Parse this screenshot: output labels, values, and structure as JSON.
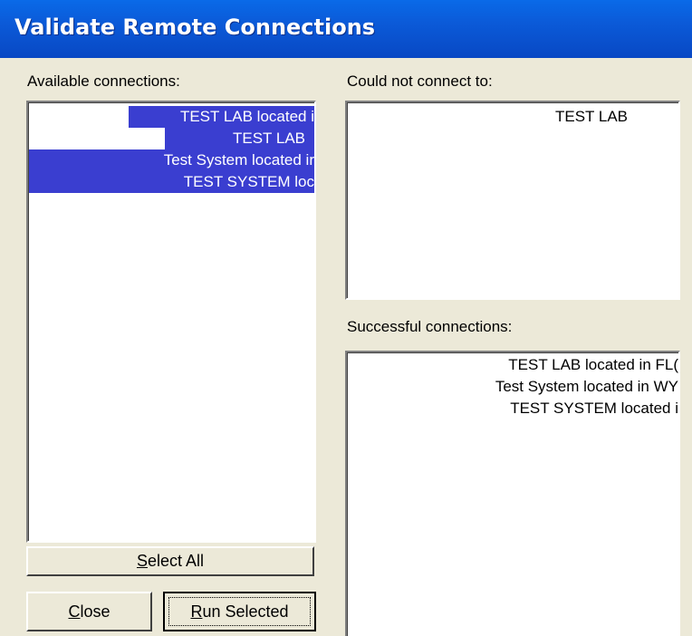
{
  "window": {
    "title": "Validate Remote Connections"
  },
  "available": {
    "label": "Available connections:",
    "items": [
      {
        "text": "TEST LAB located i",
        "selected": true
      },
      {
        "text": "TEST LAB",
        "selected": true
      },
      {
        "text": "Test System located ir",
        "selected": true
      },
      {
        "text": "TEST SYSTEM loc",
        "selected": true
      }
    ]
  },
  "failed": {
    "label": "Could not connect to:",
    "items": [
      {
        "text": "TEST LAB"
      }
    ]
  },
  "successful": {
    "label": "Successful connections:",
    "items": [
      {
        "text": "TEST LAB located in FL("
      },
      {
        "text": "Test System located in WY"
      },
      {
        "text": "TEST SYSTEM located i"
      }
    ]
  },
  "buttons": {
    "select_all_mnemonic": "S",
    "select_all_rest": "elect All",
    "close_mnemonic": "C",
    "close_rest": "lose",
    "run_mnemonic": "R",
    "run_rest": "un Selected"
  }
}
